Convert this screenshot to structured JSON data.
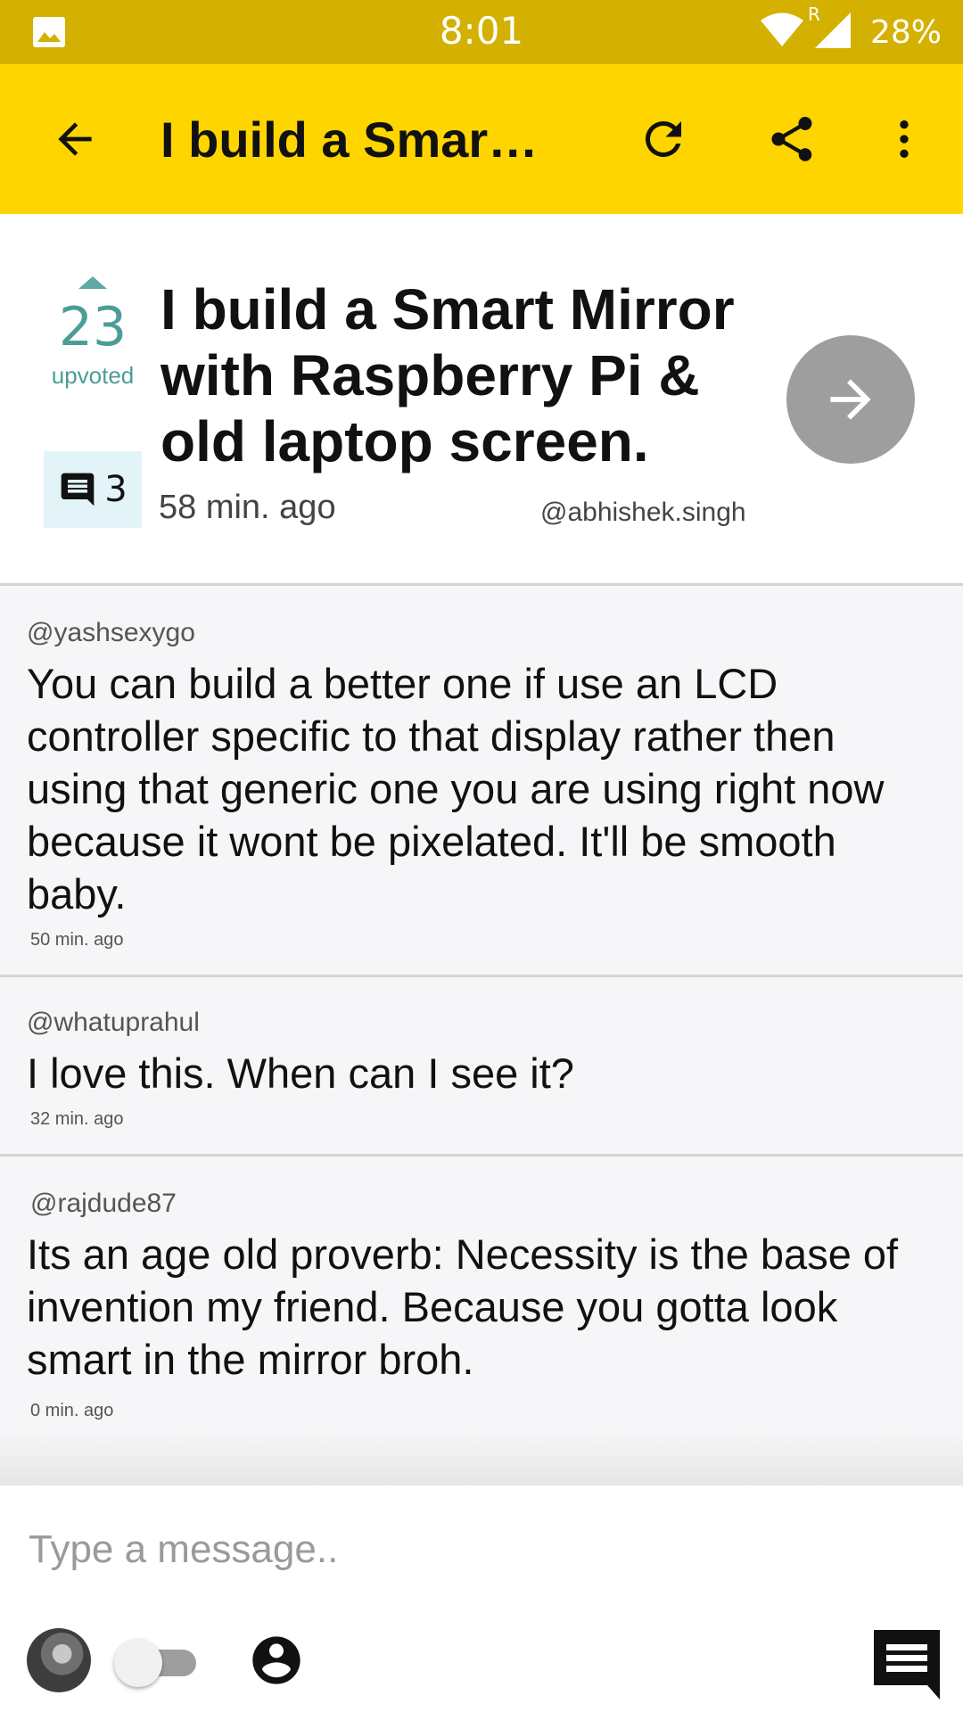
{
  "status_bar": {
    "time": "8:01",
    "battery": "28%",
    "network_label": "R",
    "icons": [
      "image-icon",
      "wifi-icon",
      "cellular-signal-icon"
    ]
  },
  "app_bar": {
    "title": "I build a Smart Mirror with Raspberry Pi & old laptop screen.",
    "icons": [
      "back-arrow-icon",
      "refresh-icon",
      "share-icon",
      "more-vert-icon"
    ],
    "background": "#ffd500"
  },
  "post": {
    "votes": "23",
    "vote_label": "upvoted",
    "comment_count": "3",
    "title": "I build a Smart Mirror with Raspberry Pi & old laptop screen.",
    "time": "58 min. ago",
    "author": "@abhishek.singh",
    "accent": "#4a9e96"
  },
  "comments": [
    {
      "author": "@yashsexygo",
      "text": "You can build a better one if use an LCD controller specific to that display rather then using that generic one you are using right now because it wont be pixelated. It'll be smooth baby.",
      "time": "50 min. ago"
    },
    {
      "author": "@whatuprahul",
      "text": "I love this. When can I see it?",
      "time": "32 min. ago"
    },
    {
      "author": "@rajdude87",
      "text": "Its an age old proverb: Necessity is the base of invention my friend. Because you gotta look smart in the mirror broh.",
      "time": "0 min. ago"
    }
  ],
  "composer": {
    "placeholder": "Type a message..",
    "value": "",
    "icons": [
      "avatar",
      "anonymous-toggle",
      "account-circle-icon",
      "send-chat-icon"
    ]
  }
}
